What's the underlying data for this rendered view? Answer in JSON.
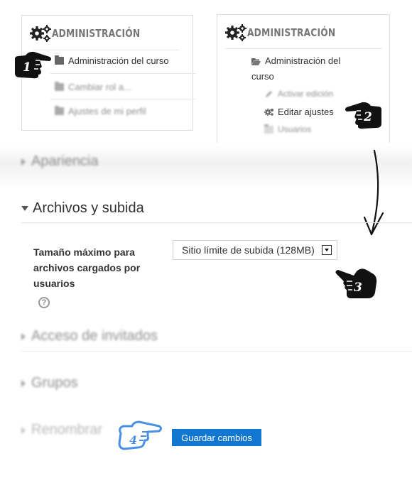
{
  "admin_block_1": {
    "title": "ADMINISTRACIÓN",
    "items": [
      {
        "label": "Administración del curso",
        "icon": "folder-icon"
      },
      {
        "label": "Cambiar rol a...",
        "icon": "folder-icon"
      },
      {
        "label": "Ajustes de mi perfil",
        "icon": "folder-icon"
      }
    ]
  },
  "admin_block_2": {
    "title": "ADMINISTRACIÓN",
    "course_admin_line1": "Administración del",
    "course_admin_line2": "curso",
    "items": [
      {
        "label": "Activar edición",
        "icon": "pencil-icon"
      },
      {
        "label": "Editar ajustes",
        "icon": "gear-icon"
      },
      {
        "label": "Usuarios",
        "icon": "folder-icon"
      }
    ]
  },
  "steps": [
    "1",
    "2",
    "3",
    "4"
  ],
  "settings": {
    "section_appearance": "Apariencia",
    "section_files": "Archivos y subida",
    "max_upload_label": "Tamaño máximo para archivos cargados por usuarios",
    "max_upload_value": "Sitio límite de subida (128MB)",
    "section_guests": "Acceso de invitados",
    "section_groups": "Grupos",
    "section_rename": "Renombrar",
    "save_button": "Guardar cambios"
  },
  "colors": {
    "accent": "#1177d1",
    "hand_step4": "#4a90e2",
    "hand_default": "#111111"
  }
}
